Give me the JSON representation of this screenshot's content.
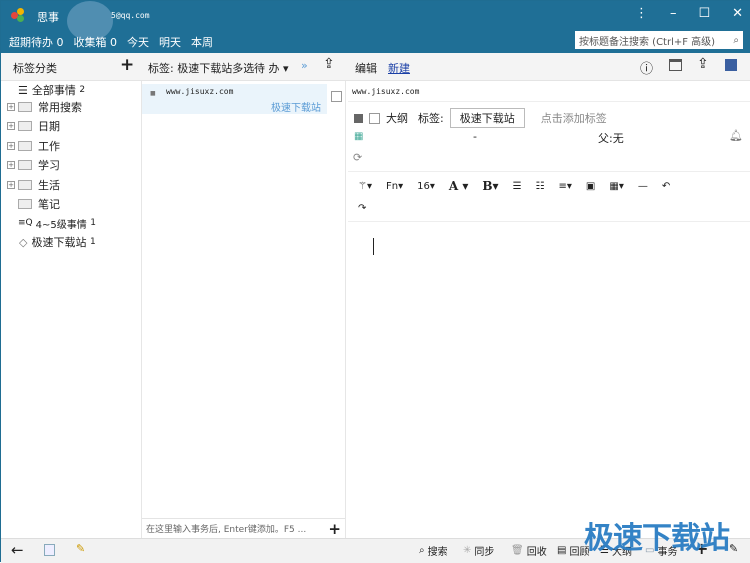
{
  "titlebar": {
    "app_name": "思事",
    "account": "5@qq.com",
    "search_placeholder": "按标题备注搜索 (Ctrl+F 高级)"
  },
  "nav": [
    {
      "label": "超期待办",
      "count": "0"
    },
    {
      "label": "收集箱",
      "count": "0"
    },
    {
      "label": "今天"
    },
    {
      "label": "明天"
    },
    {
      "label": "本周"
    }
  ],
  "sidebar": {
    "header": "标签分类",
    "add": "+",
    "items": [
      {
        "label": "全部事情",
        "count": "2"
      },
      {
        "label": "常用搜索"
      },
      {
        "label": "日期"
      },
      {
        "label": "工作"
      },
      {
        "label": "学习"
      },
      {
        "label": "生活"
      },
      {
        "label": "笔记"
      },
      {
        "label": "4~5级事情",
        "count": "1"
      },
      {
        "label": "极速下载站",
        "count": "1"
      }
    ]
  },
  "list": {
    "header": "标签: 极速下载站多选",
    "filter": "待 办",
    "item_title": "www.jisuxz.com",
    "item_tag": "极速下载站",
    "input_placeholder": "在这里输入事务后, Enter键添加。F5 ...",
    "add": "+"
  },
  "editor": {
    "edit": "编辑",
    "new": "新建",
    "title": "www.jisuxz.com",
    "outline": "大纲",
    "tag_label": "标签:",
    "tag_value": "极速下载站",
    "add_tag": "点击添加标签",
    "date": "-",
    "parent": "父:无",
    "font": "Fn",
    "size": "16",
    "bold": "B",
    "color": "A"
  },
  "bottom": {
    "search": "搜索",
    "sync": "同步",
    "recycle": "回收",
    "review": "回顾",
    "outline": "大纲",
    "task": "事务",
    "add": "+"
  },
  "watermark": "极速下载站"
}
